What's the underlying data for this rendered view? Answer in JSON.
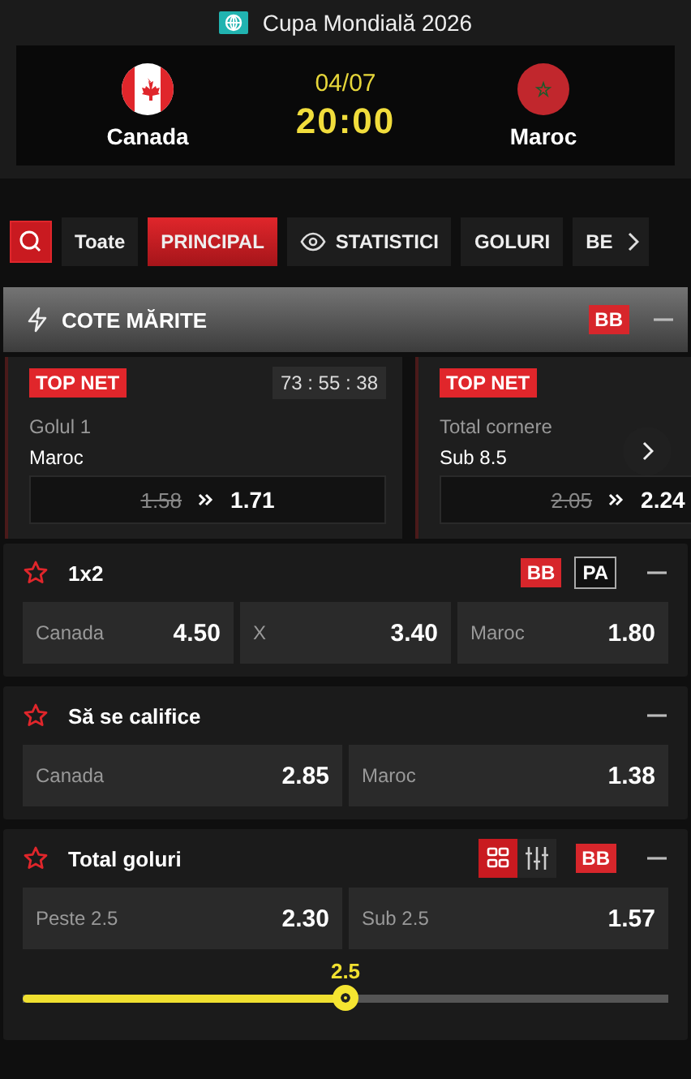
{
  "competition": {
    "title": "Cupa Mondială 2026"
  },
  "match": {
    "home": "Canada",
    "away": "Maroc",
    "date": "04/07",
    "time": "20:00"
  },
  "tabs": [
    {
      "label": "Toate",
      "kind": "text",
      "selected": false
    },
    {
      "label": "PRINCIPAL",
      "kind": "text",
      "selected": true
    },
    {
      "label": "STATISTICI",
      "kind": "eye",
      "selected": false
    },
    {
      "label": "GOLURI",
      "kind": "text",
      "selected": false
    },
    {
      "label": "BE",
      "kind": "text",
      "selected": false
    }
  ],
  "boosted": {
    "title": "COTE MĂRITE",
    "badge": "BB",
    "cards": [
      {
        "tag": "TOP NET",
        "countdown": "73 : 55 : 38",
        "market": "Golul 1",
        "selection": "Maroc",
        "old_odds": "1.58",
        "new_odds": "1.71"
      },
      {
        "tag": "TOP NET",
        "market": "Total cornere",
        "selection": "Sub 8.5",
        "old_odds": "2.05",
        "new_odds": "2.24"
      }
    ]
  },
  "markets": [
    {
      "title": "1x2",
      "badges": [
        {
          "label": "BB",
          "kind": "filled"
        },
        {
          "label": "PA",
          "kind": "outline"
        }
      ],
      "outcomes": [
        {
          "label": "Canada",
          "odds": "4.50"
        },
        {
          "label": "X",
          "odds": "3.40"
        },
        {
          "label": "Maroc",
          "odds": "1.80"
        }
      ]
    },
    {
      "title": "Să se califice",
      "outcomes": [
        {
          "label": "Canada",
          "odds": "2.85"
        },
        {
          "label": "Maroc",
          "odds": "1.38"
        }
      ]
    },
    {
      "title": "Total goluri",
      "views": [
        {
          "kind": "grid",
          "selected": true
        },
        {
          "kind": "sliders",
          "selected": false
        }
      ],
      "badges": [
        {
          "label": "BB",
          "kind": "filled"
        }
      ],
      "outcomes": [
        {
          "label": "Peste 2.5",
          "odds": "2.30"
        },
        {
          "label": "Sub 2.5",
          "odds": "1.57"
        }
      ],
      "slider": {
        "value": "2.5",
        "level": 0.5
      }
    }
  ]
}
